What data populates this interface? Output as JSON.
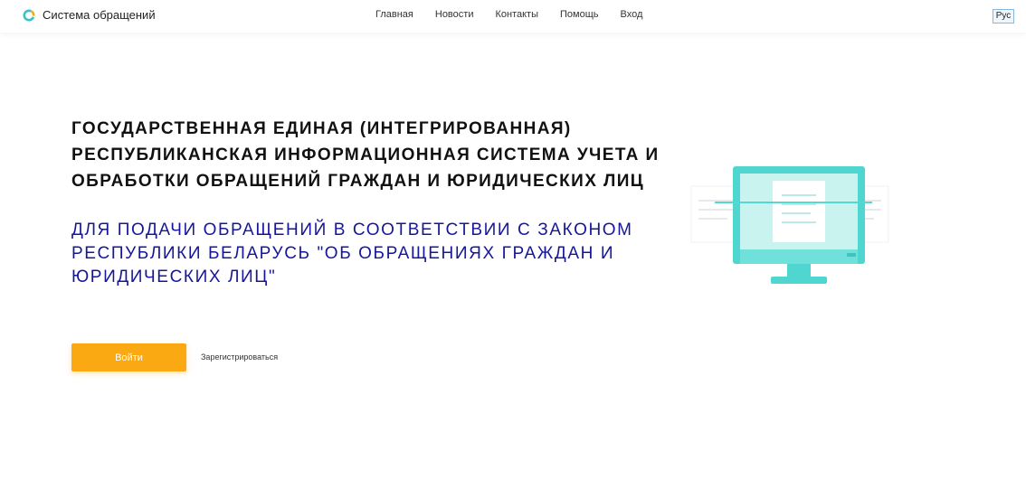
{
  "header": {
    "brand_name": "Система обращений",
    "nav": [
      "Главная",
      "Новости",
      "Контакты",
      "Помощь",
      "Вход"
    ],
    "language": "Рус"
  },
  "hero": {
    "title": "Государственная единая (интегрированная) республиканская информационная система учета и обработки обращений граждан и юридических лиц",
    "subtitle": "для подачи обращений в соответствии с Законом Республики Беларусь \"Об обращениях граждан и юридических лиц\"",
    "login_button": "Войти",
    "register_link": "Зарегистрироваться"
  },
  "colors": {
    "accent": "#fba913",
    "subtitle": "#16169a",
    "illustration": "#4fd6d0"
  },
  "icons": {
    "logo": "brand-logo-icon",
    "illustration": "monitor-illustration"
  }
}
